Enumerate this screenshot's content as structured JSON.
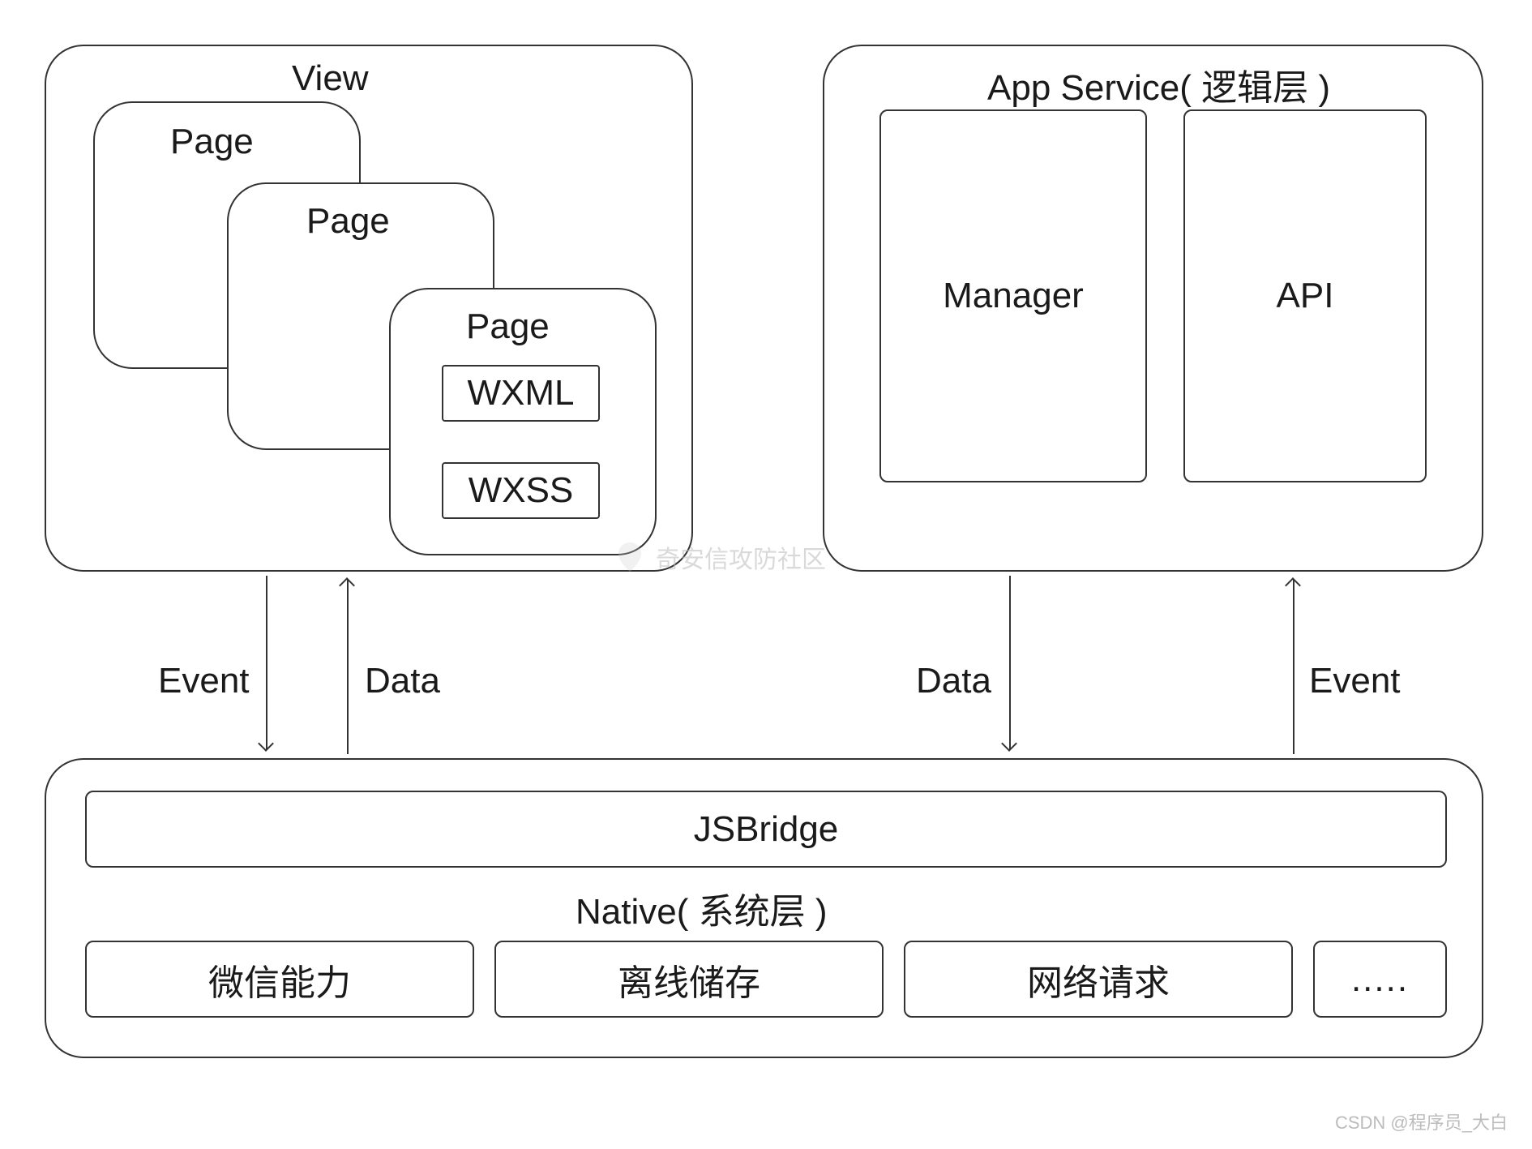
{
  "view": {
    "title": "View",
    "page1": "Page",
    "page2": "Page",
    "page3": "Page",
    "wxml": "WXML",
    "wxss": "WXSS"
  },
  "appservice": {
    "title": "App Service( 逻辑层 )",
    "manager": "Manager",
    "api": "API"
  },
  "arrows": {
    "view_event": "Event",
    "view_data": "Data",
    "service_data": "Data",
    "service_event": "Event"
  },
  "native": {
    "jsbridge": "JSBridge",
    "title": "Native( 系统层 )",
    "items": [
      "微信能力",
      "离线储存",
      "网络请求",
      "....."
    ]
  },
  "watermark": "奇安信攻防社区",
  "footer": "CSDN @程序员_大白"
}
